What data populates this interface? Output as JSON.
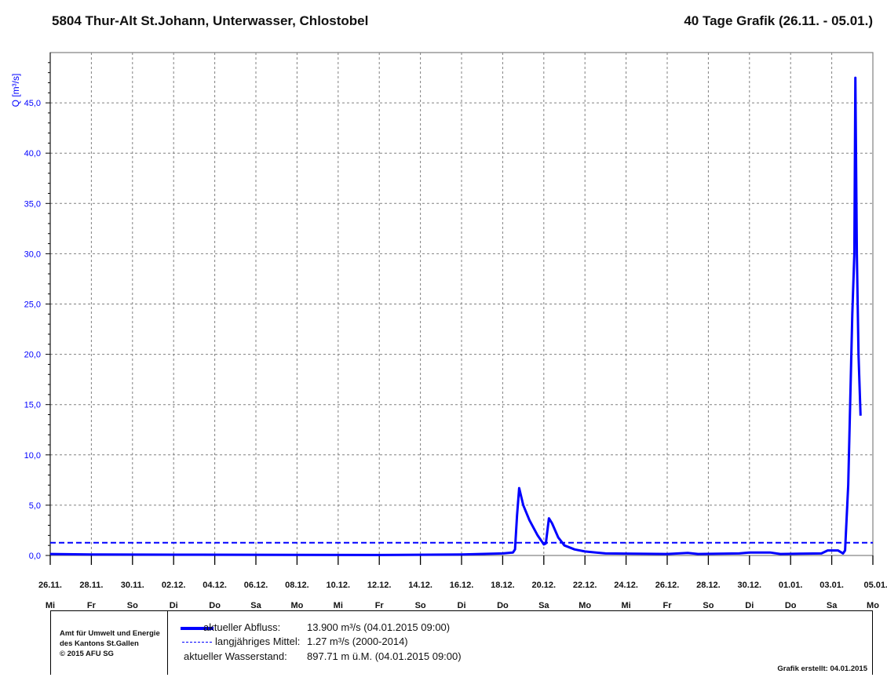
{
  "header": {
    "station": "5804 Thur-Alt St.Johann, Unterwasser, Chlostobel",
    "range": "40 Tage Grafik (26.11. - 05.01.)"
  },
  "legend": {
    "org_lines": [
      "Amt für Umwelt und Energie",
      "des Kantons St.Gallen",
      "© 2015 AFU SG"
    ],
    "rows": [
      {
        "label": "aktueller Abfluss:",
        "value": "13.900 m³/s (04.01.2015 09:00)"
      },
      {
        "label": "langjähriges Mittel:",
        "value": "1.27 m³/s (2000-2014)"
      },
      {
        "label": "aktueller Wasserstand:",
        "value": "897.71 m ü.M. (04.01.2015 09:00)"
      }
    ],
    "created": "Grafik erstellt: 04.01.2015"
  },
  "colors": {
    "series": "#0000ff",
    "grid": "#808080",
    "axis_label": "#0000ff"
  },
  "chart_data": {
    "type": "line",
    "title": "5804 Thur-Alt St.Johann, Unterwasser, Chlostobel",
    "ylabel": "Q [m³/s]",
    "xlabel": "",
    "ylim": [
      0,
      50
    ],
    "xlim_days": [
      0,
      40
    ],
    "y_ticks": [
      "0,0",
      "5,0",
      "10,0",
      "15,0",
      "20,0",
      "25,0",
      "30,0",
      "35,0",
      "40,0",
      "45,0"
    ],
    "x_date_labels": [
      "26.11.",
      "28.11.",
      "30.11.",
      "02.12.",
      "04.12.",
      "06.12.",
      "08.12.",
      "10.12.",
      "12.12.",
      "14.12.",
      "16.12.",
      "18.12.",
      "20.12.",
      "22.12.",
      "24.12.",
      "26.12.",
      "28.12.",
      "30.12.",
      "01.01.",
      "03.01.",
      "05.01.2015"
    ],
    "x_weekday_labels": [
      "Mi",
      "Fr",
      "So",
      "Di",
      "Do",
      "Sa",
      "Mo",
      "Mi",
      "Fr",
      "So",
      "Di",
      "Do",
      "Sa",
      "Mo",
      "Mi",
      "Fr",
      "So",
      "Di",
      "Do",
      "Sa",
      "Mo"
    ],
    "grid": true,
    "series": [
      {
        "name": "aktueller Abfluss",
        "style": "solid",
        "points": [
          [
            0,
            0.15
          ],
          [
            2,
            0.1
          ],
          [
            6,
            0.08
          ],
          [
            12,
            0.06
          ],
          [
            16,
            0.05
          ],
          [
            20,
            0.1
          ],
          [
            22,
            0.2
          ],
          [
            22.5,
            0.3
          ],
          [
            22.6,
            0.6
          ],
          [
            22.7,
            4
          ],
          [
            22.8,
            6.7
          ],
          [
            23,
            5
          ],
          [
            23.3,
            3.5
          ],
          [
            23.7,
            2
          ],
          [
            24,
            1.1
          ],
          [
            24.1,
            1.2
          ],
          [
            24.25,
            3.7
          ],
          [
            24.4,
            3.2
          ],
          [
            24.7,
            1.8
          ],
          [
            25,
            1
          ],
          [
            25.5,
            0.6
          ],
          [
            26,
            0.4
          ],
          [
            27,
            0.2
          ],
          [
            30,
            0.15
          ],
          [
            31,
            0.25
          ],
          [
            31.5,
            0.15
          ],
          [
            33.5,
            0.2
          ],
          [
            34,
            0.3
          ],
          [
            35,
            0.3
          ],
          [
            35.5,
            0.15
          ],
          [
            37.5,
            0.2
          ],
          [
            37.8,
            0.5
          ],
          [
            38.3,
            0.5
          ],
          [
            38.55,
            0.2
          ],
          [
            38.65,
            0.5
          ],
          [
            38.8,
            7
          ],
          [
            39.0,
            24
          ],
          [
            39.1,
            30
          ],
          [
            39.15,
            47.5
          ],
          [
            39.22,
            30
          ],
          [
            39.3,
            20
          ],
          [
            39.4,
            13.9
          ]
        ]
      },
      {
        "name": "langjähriges Mittel",
        "style": "dashed",
        "value": 1.27
      }
    ]
  }
}
